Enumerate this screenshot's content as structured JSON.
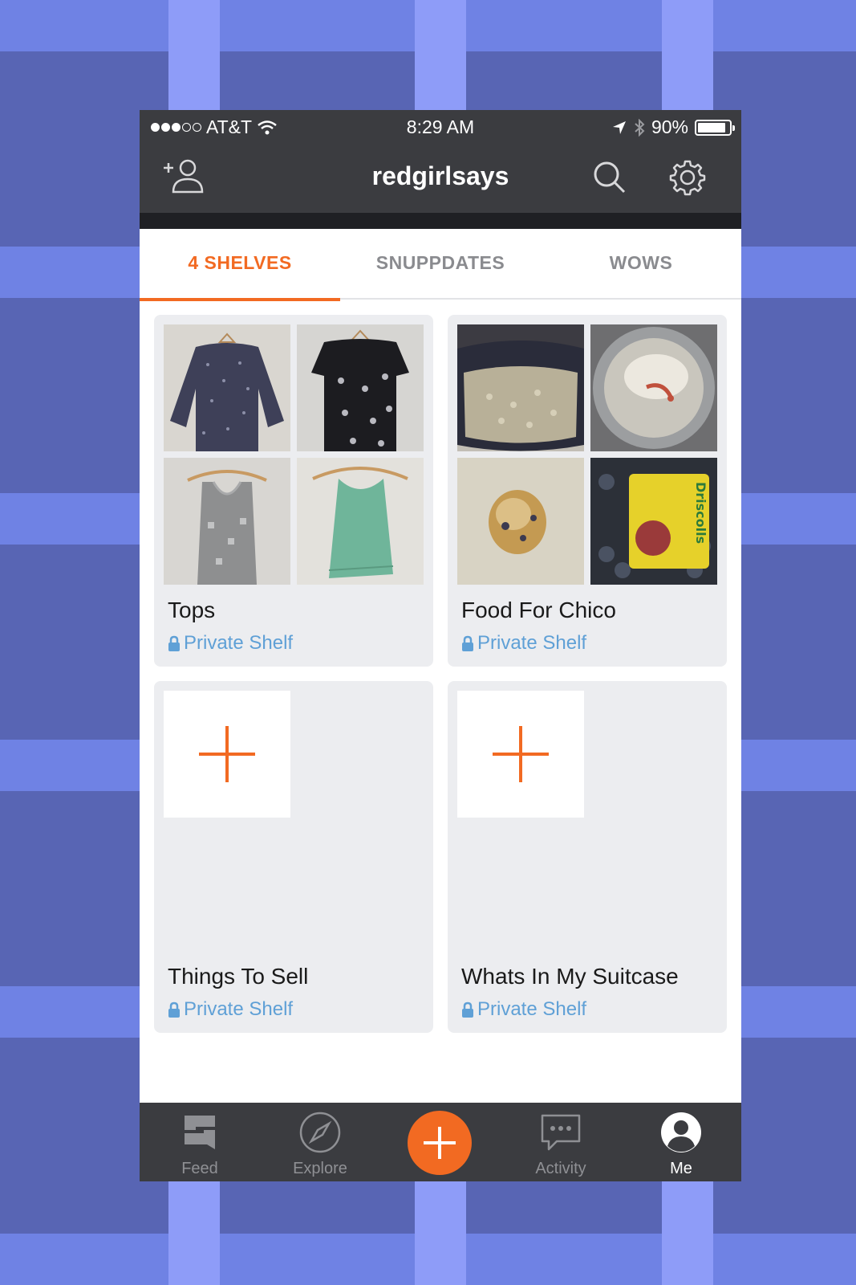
{
  "status_bar": {
    "carrier": "AT&T",
    "time": "8:29 AM",
    "battery": "90%",
    "battery_level": 0.9
  },
  "nav": {
    "title": "redgirlsays",
    "add_friend_icon": "add-person-icon",
    "search_icon": "search-icon",
    "settings_icon": "gear-icon"
  },
  "tabs": [
    {
      "label": "4 SHELVES",
      "active": true
    },
    {
      "label": "SNUPPDATES",
      "active": false
    },
    {
      "label": "WOWS",
      "active": false
    }
  ],
  "shelves": [
    {
      "title": "Tops",
      "privacy": "Private Shelf"
    },
    {
      "title": "Food For Chico",
      "privacy": "Private Shelf"
    },
    {
      "title": "Things To Sell",
      "privacy": "Private Shelf"
    },
    {
      "title": "Whats In My Suitcase",
      "privacy": "Private Shelf"
    }
  ],
  "tab_bar": [
    {
      "label": "Feed",
      "icon": "snupps-s-icon"
    },
    {
      "label": "Explore",
      "icon": "compass-icon"
    },
    {
      "label": "",
      "icon": "plus-icon"
    },
    {
      "label": "Activity",
      "icon": "chat-bubble-icon"
    },
    {
      "label": "Me",
      "icon": "profile-icon",
      "active": true
    }
  ],
  "colors": {
    "accent": "#f26a22",
    "dark_bar": "#3b3c40",
    "link_blue": "#5fa0d6",
    "card_bg": "#ecedf0"
  }
}
